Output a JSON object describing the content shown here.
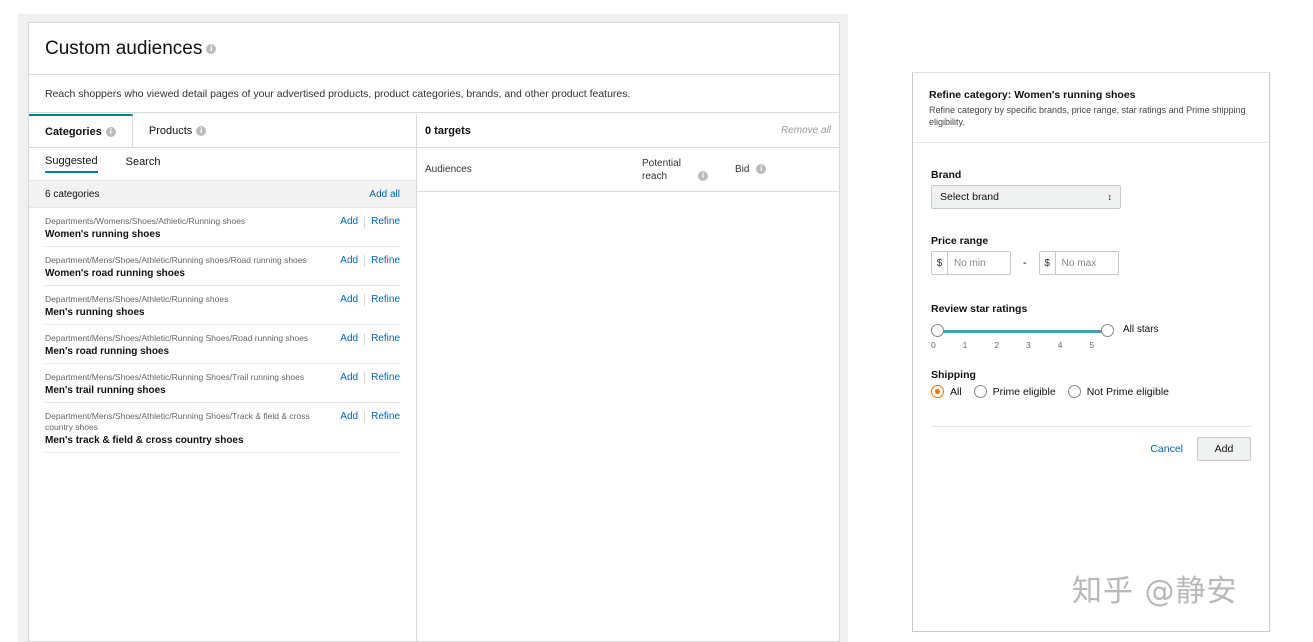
{
  "left": {
    "title": "Custom audiences",
    "description": "Reach shoppers who viewed detail pages of your advertised products, product categories, brands, and other product features.",
    "tabs": [
      {
        "label": "Categories"
      },
      {
        "label": "Products"
      }
    ],
    "subtabs": [
      {
        "label": "Suggested"
      },
      {
        "label": "Search"
      }
    ],
    "count_label": "6 categories",
    "add_all": "Add all",
    "add_label": "Add",
    "refine_label": "Refine",
    "categories": [
      {
        "path": "Departments/Womens/Shoes/Athletic/Running shoes",
        "name": "Women's running shoes"
      },
      {
        "path": "Department/Mens/Shoes/Athletic/Running shoes/Road running shoes",
        "name": "Women's road running shoes"
      },
      {
        "path": "Department/Mens/Shoes/Athletic/Running shoes",
        "name": "Men's running shoes"
      },
      {
        "path": "Department/Mens/Shoes/Athletic/Running Shoes/Road running shoes",
        "name": "Men's road running shoes"
      },
      {
        "path": "Department/Mens/Shoes/Athletic/Running Shoes/Trail running shoes",
        "name": "Men's trail running shoes"
      },
      {
        "path": "Department/Mens/Shoes/Athletic/Running Shoes/Track & field & cross country shoes",
        "name": "Men's track & field & cross country shoes"
      }
    ],
    "targets": {
      "count": "0 targets",
      "remove_all": "Remove all",
      "col_audiences": "Audiences",
      "col_reach": "Potential reach",
      "col_bid": "Bid"
    }
  },
  "dialog": {
    "title": "Refine category: Women's running shoes",
    "subtitle": "Refine category by specific brands, price range, star ratings and Prime shipping eligibility.",
    "brand_label": "Brand",
    "brand_select": "Select brand",
    "price_label": "Price range",
    "currency": "$",
    "min_placeholder": "No min",
    "max_placeholder": "No max",
    "rating_label": "Review star ratings",
    "rating_ticks": [
      "0",
      "1",
      "2",
      "3",
      "4",
      "5"
    ],
    "rating_selected_min": 0,
    "rating_selected_max": 5,
    "rating_value_text": "All stars",
    "shipping_label": "Shipping",
    "shipping_options": [
      {
        "label": "All",
        "selected": true
      },
      {
        "label": "Prime eligible",
        "selected": false
      },
      {
        "label": "Not Prime eligible",
        "selected": false
      }
    ],
    "cancel": "Cancel",
    "add": "Add"
  },
  "watermark": "知乎 @静安",
  "colors": {
    "accent": "#008296",
    "link": "#0066c0",
    "radio": "#e77600"
  }
}
